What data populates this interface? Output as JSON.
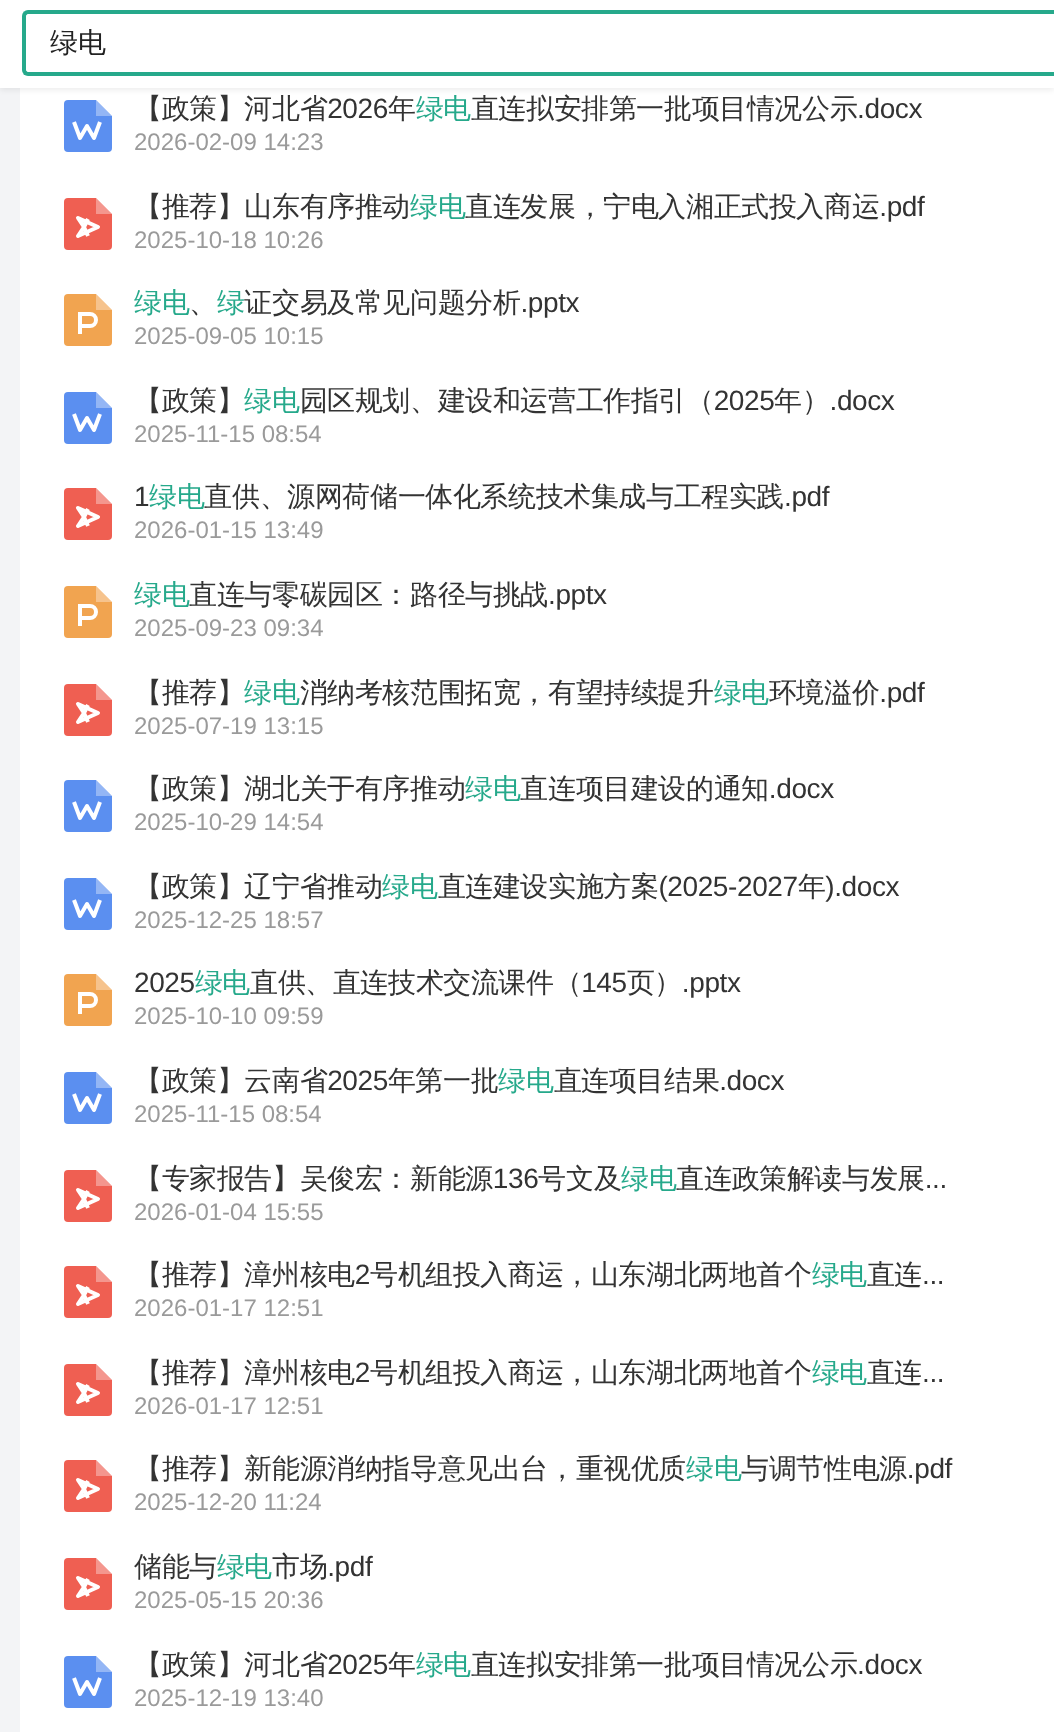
{
  "search": {
    "value": "绿电"
  },
  "results": [
    {
      "kind": "word",
      "title": [
        {
          "text": "【政策】河北省2026年"
        },
        {
          "text": "绿电",
          "highlight": true
        },
        {
          "text": "直连拟安排第一批项目情况公示.docx"
        }
      ],
      "date": "2026-02-09 14:23"
    },
    {
      "kind": "pdf",
      "title": [
        {
          "text": "【推荐】山东有序推动"
        },
        {
          "text": "绿电",
          "highlight": true
        },
        {
          "text": "直连发展，宁电入湘正式投入商运.pdf"
        }
      ],
      "date": "2025-10-18 10:26"
    },
    {
      "kind": "ppt",
      "title": [
        {
          "text": "绿电",
          "highlight": true
        },
        {
          "text": "、"
        },
        {
          "text": "绿",
          "highlight": true
        },
        {
          "text": "证交易及常见问题分析.pptx"
        }
      ],
      "date": "2025-09-05 10:15"
    },
    {
      "kind": "word",
      "title": [
        {
          "text": "【政策】"
        },
        {
          "text": "绿电",
          "highlight": true
        },
        {
          "text": "园区规划、建设和运营工作指引（2025年）.docx"
        }
      ],
      "date": "2025-11-15 08:54"
    },
    {
      "kind": "pdf",
      "title": [
        {
          "text": "1"
        },
        {
          "text": "绿电",
          "highlight": true
        },
        {
          "text": "直供、源网荷储一体化系统技术集成与工程实践.pdf"
        }
      ],
      "date": "2026-01-15 13:49"
    },
    {
      "kind": "ppt",
      "title": [
        {
          "text": "绿电",
          "highlight": true
        },
        {
          "text": "直连与零碳园区：路径与挑战.pptx"
        }
      ],
      "date": "2025-09-23 09:34"
    },
    {
      "kind": "pdf",
      "title": [
        {
          "text": "【推荐】"
        },
        {
          "text": "绿电",
          "highlight": true
        },
        {
          "text": "消纳考核范围拓宽，有望持续提升"
        },
        {
          "text": "绿电",
          "highlight": true
        },
        {
          "text": "环境溢价.pdf"
        }
      ],
      "date": "2025-07-19 13:15"
    },
    {
      "kind": "word",
      "title": [
        {
          "text": "【政策】湖北关于有序推动"
        },
        {
          "text": "绿电",
          "highlight": true
        },
        {
          "text": "直连项目建设的通知.docx"
        }
      ],
      "date": "2025-10-29 14:54"
    },
    {
      "kind": "word",
      "title": [
        {
          "text": "【政策】辽宁省推动"
        },
        {
          "text": "绿电",
          "highlight": true
        },
        {
          "text": "直连建设实施方案(2025-2027年).docx"
        }
      ],
      "date": "2025-12-25 18:57"
    },
    {
      "kind": "ppt",
      "title": [
        {
          "text": "2025"
        },
        {
          "text": "绿电",
          "highlight": true
        },
        {
          "text": "直供、直连技术交流课件（145页）.pptx"
        }
      ],
      "date": "2025-10-10 09:59"
    },
    {
      "kind": "word",
      "title": [
        {
          "text": "【政策】云南省2025年第一批"
        },
        {
          "text": "绿电",
          "highlight": true
        },
        {
          "text": "直连项目结果.docx"
        }
      ],
      "date": "2025-11-15 08:54"
    },
    {
      "kind": "pdf",
      "title": [
        {
          "text": "【专家报告】吴俊宏：新能源136号文及"
        },
        {
          "text": "绿电",
          "highlight": true
        },
        {
          "text": "直连政策解读与发展..."
        }
      ],
      "date": "2026-01-04 15:55"
    },
    {
      "kind": "pdf",
      "title": [
        {
          "text": "【推荐】漳州核电2号机组投入商运，山东湖北两地首个"
        },
        {
          "text": "绿电",
          "highlight": true
        },
        {
          "text": "直连..."
        }
      ],
      "date": "2026-01-17 12:51"
    },
    {
      "kind": "pdf",
      "title": [
        {
          "text": "【推荐】漳州核电2号机组投入商运，山东湖北两地首个"
        },
        {
          "text": "绿电",
          "highlight": true
        },
        {
          "text": "直连..."
        }
      ],
      "date": "2026-01-17 12:51"
    },
    {
      "kind": "pdf",
      "title": [
        {
          "text": "【推荐】新能源消纳指导意见出台，重视优质"
        },
        {
          "text": "绿电",
          "highlight": true
        },
        {
          "text": "与调节性电源.pdf"
        }
      ],
      "date": "2025-12-20 11:24"
    },
    {
      "kind": "pdf",
      "title": [
        {
          "text": "储能与"
        },
        {
          "text": "绿电",
          "highlight": true
        },
        {
          "text": "市场.pdf"
        }
      ],
      "date": "2025-05-15 20:36"
    },
    {
      "kind": "word",
      "title": [
        {
          "text": "【政策】河北省2025年"
        },
        {
          "text": "绿电",
          "highlight": true
        },
        {
          "text": "直连拟安排第一批项目情况公示.docx"
        }
      ],
      "date": "2025-12-19 13:40"
    }
  ]
}
